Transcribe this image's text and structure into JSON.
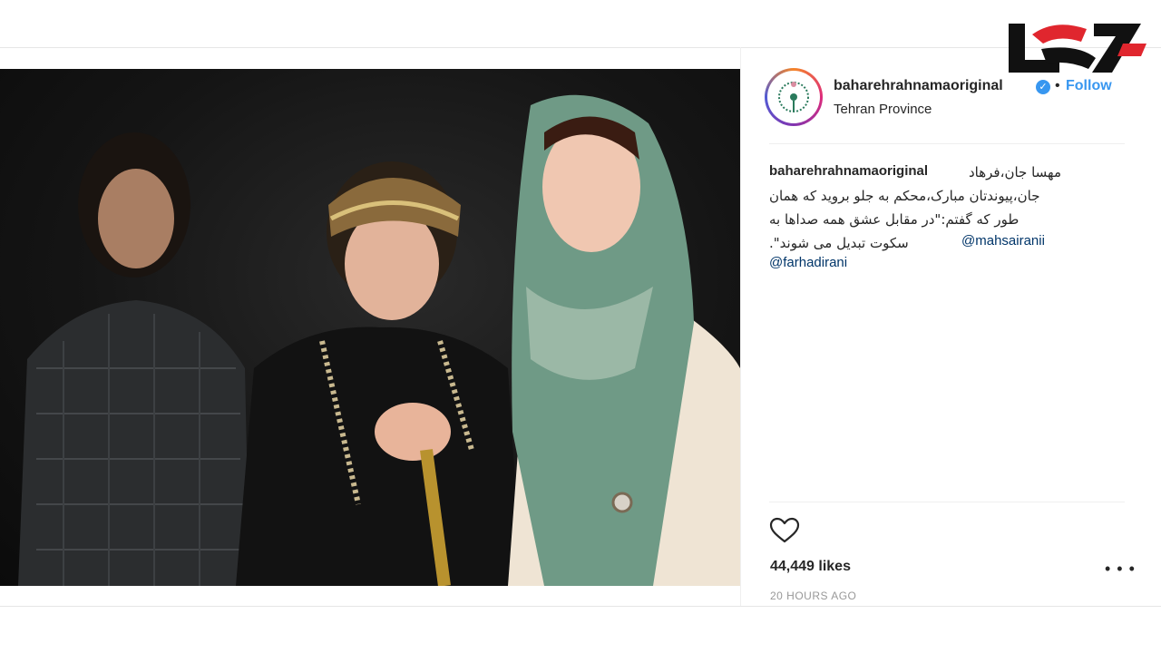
{
  "post": {
    "username": "baharehrahnamaoriginal",
    "verified_badge": "✓",
    "separator": "•",
    "follow_label": "Follow",
    "location": "Tehran Province",
    "caption": {
      "user": "baharehrahnamaoriginal",
      "line1": "مهسا جان،فرهاد",
      "line2": "جان،پیوندتان مبارک،محکم به جلو بروید که همان",
      "line3": "طور که گفتم:\"در مقابل عشق همه صداها به",
      "line4": "سکوت تبدیل می شوند\".",
      "mention1": "@mahsairanii",
      "mention2": "@farhadirani"
    },
    "likes": "44,449 likes",
    "timestamp": "20 HOURS AGO",
    "more_glyph": "• • •",
    "carousel": {
      "count": 2,
      "active": 0
    }
  },
  "icons": {
    "heart": "heart-outline-icon",
    "more": "more-options-icon",
    "verified": "verified-badge-icon"
  },
  "colors": {
    "link": "#3897f0",
    "mention": "#003569",
    "text": "#262626",
    "muted": "#999999",
    "watermark_red": "#e0262e"
  }
}
